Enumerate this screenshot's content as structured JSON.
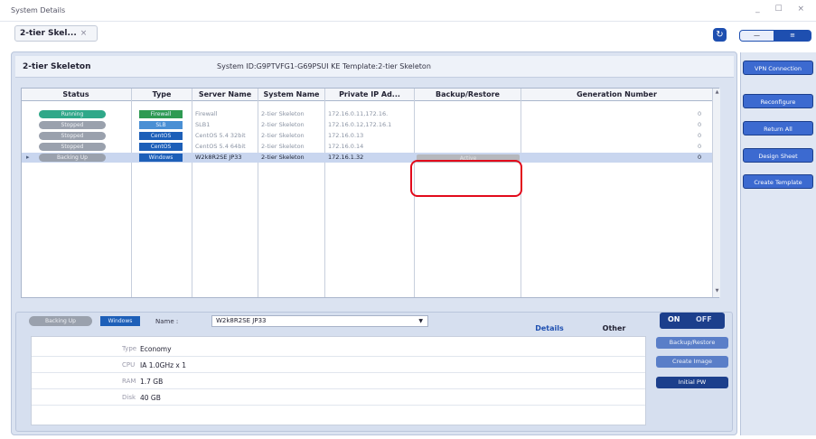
{
  "window": {
    "title": "System Details",
    "controls": "_ ☐ ×"
  },
  "tab": {
    "label": "2-tier Skel...",
    "close": "×"
  },
  "refresh_icon": "↻",
  "view_toggle": {
    "left": "—",
    "right": "≡"
  },
  "system": {
    "name": "2-tier Skeleton",
    "info": "System ID:G9PTVFG1-G69PSUI KE  Template:2-tier Skeleton"
  },
  "table": {
    "headers": [
      "Status",
      "Type",
      "Server Name",
      "System Name",
      "Private IP Ad...",
      "Backup/Restore",
      "Generation Number"
    ],
    "rows": [
      {
        "status": "Running",
        "status_color": "#2fa889",
        "type": "Firewall",
        "type_color": "#2e9a52",
        "server": "Firewall",
        "system": "2-tier Skeleton",
        "ip": "172.16.0.11,172.16.",
        "backup": "",
        "gen": "0",
        "selected": false
      },
      {
        "status": "Stopped",
        "status_color": "#9aa1ad",
        "type": "SLB",
        "type_color": "#4a8fd4",
        "server": "SLB1",
        "system": "2-tier Skeleton",
        "ip": "172.16.0.12,172.16.1",
        "backup": "",
        "gen": "0",
        "selected": false
      },
      {
        "status": "Stopped",
        "status_color": "#9aa1ad",
        "type": "CentOS",
        "type_color": "#1d5fb8",
        "server": "CentOS 5.4 32bit",
        "system": "2-tier Skeleton",
        "ip": "172.16.0.13",
        "backup": "",
        "gen": "0",
        "selected": false
      },
      {
        "status": "Stopped",
        "status_color": "#9aa1ad",
        "type": "CentOS",
        "type_color": "#1d5fb8",
        "server": "CentOS 5.4 64bit",
        "system": "2-tier Skeleton",
        "ip": "172.16.0.14",
        "backup": "",
        "gen": "0",
        "selected": false
      },
      {
        "status": "Backing Up",
        "status_color": "#9aa1ad",
        "type": "Windows",
        "type_color": "#1d5fb8",
        "server": "W2k8R2SE JP33",
        "system": "2-tier Skeleton",
        "ip": "172.16.1.32",
        "backup": "Active",
        "gen": "0",
        "selected": true,
        "expand": "▸"
      }
    ]
  },
  "bottom": {
    "status": "Backing Up",
    "os": "Windows",
    "name_label": "Name :",
    "name_value": "W2k8R2SE JP33",
    "select_caret": "▼",
    "tabs": {
      "details": "Details",
      "other": "Other"
    },
    "details": [
      {
        "key": "Type",
        "value": "Economy"
      },
      {
        "key": "CPU",
        "value": "IA 1.0GHz x 1"
      },
      {
        "key": "RAM",
        "value": "1.7 GB"
      },
      {
        "key": "Disk",
        "value": "40 GB"
      }
    ],
    "power": {
      "on": "ON",
      "off": "OFF"
    },
    "actions": [
      "Backup/Restore",
      "Create Image",
      "Initial PW"
    ]
  },
  "sidebar": [
    "VPN Connection",
    "Reconfigure",
    "Return All",
    "Design Sheet",
    "Create Template"
  ],
  "colors": {
    "accent": "#1e4fb0",
    "highlight": "#e20a1b"
  }
}
